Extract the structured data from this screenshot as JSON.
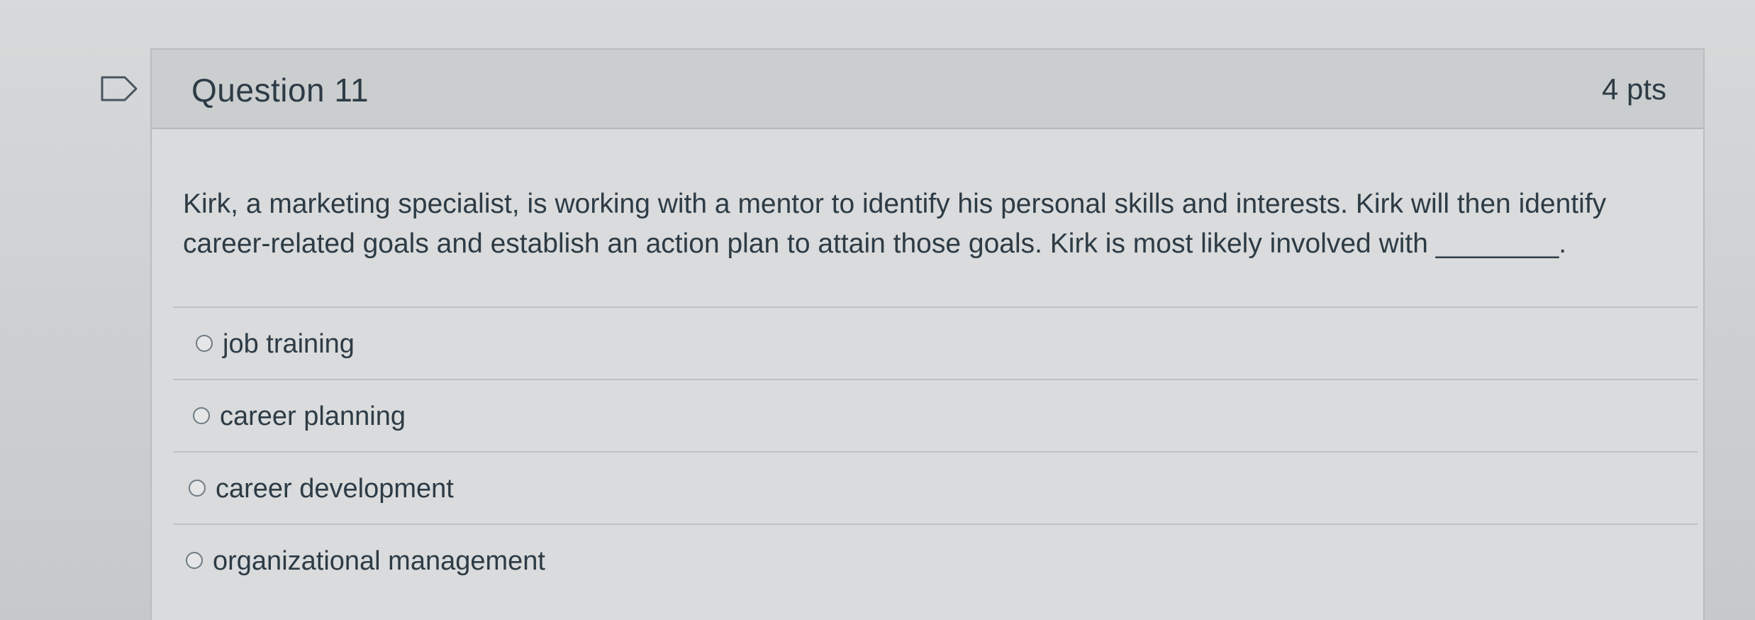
{
  "question": {
    "title": "Question 11",
    "points": "4 pts",
    "text": "Kirk, a marketing specialist, is working with a mentor to identify his personal skills and interests. Kirk will then identify career-related goals and establish an action plan to attain those goals. Kirk is most likely involved with ________."
  },
  "answers": [
    {
      "label": "job training"
    },
    {
      "label": "career planning"
    },
    {
      "label": "career development"
    },
    {
      "label": "organizational management"
    }
  ],
  "icons": {
    "flag": "flag-icon",
    "radio": "radio-unselected-icon"
  },
  "colors": {
    "text": "#2d3b45",
    "header_bg": "#cbcecf",
    "border": "#b9bdbf"
  }
}
